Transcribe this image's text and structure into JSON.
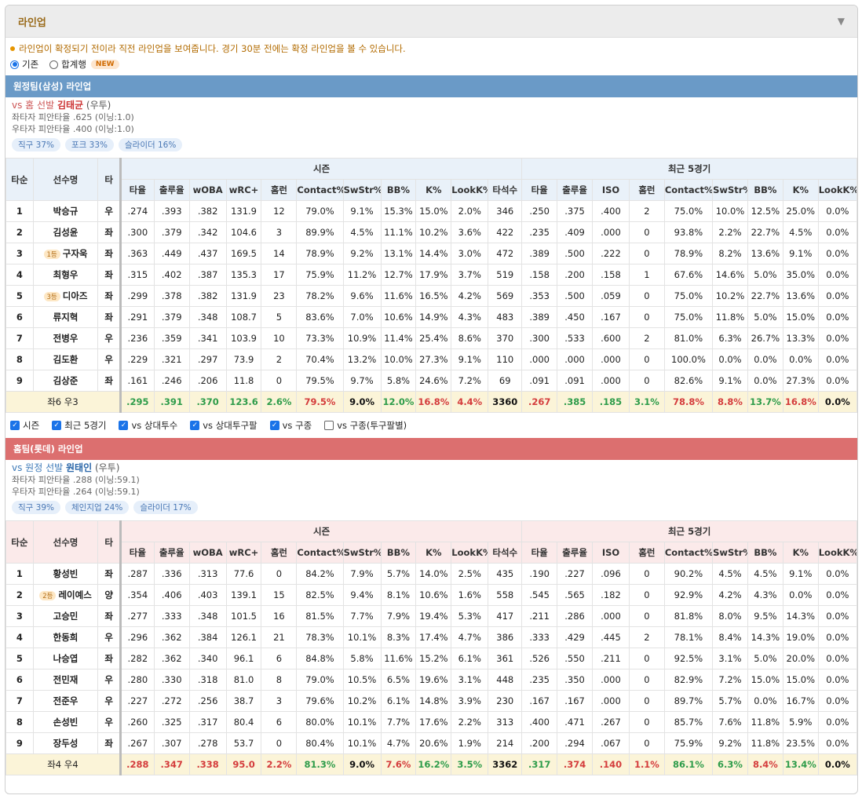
{
  "panel": {
    "title": "라인업"
  },
  "notice": "라인업이 확정되기 전이라 직전 라인업을 보여줍니다. 경기 30분 전에는 확정 라인업을 볼 수 있습니다.",
  "view_options": [
    {
      "label": "기존",
      "selected": true
    },
    {
      "label": "합계행",
      "selected": false,
      "badge": "NEW"
    }
  ],
  "headers": {
    "order": "타순",
    "name": "선수명",
    "hand": "타",
    "group_season": "시즌",
    "group_recent": "최근 5경기",
    "season_cols": [
      "타율",
      "출루율",
      "wOBA",
      "wRC+",
      "홈런",
      "Contact%",
      "SwStr%",
      "BB%",
      "K%",
      "LookK%",
      "타석수"
    ],
    "recent_cols": [
      "타율",
      "출루율",
      "ISO",
      "홈런",
      "Contact%",
      "SwStr%",
      "BB%",
      "K%",
      "LookK%"
    ]
  },
  "away": {
    "bar_title": "원정팀(삼성) 라인업",
    "vs_prefix": "vs 홈 선발",
    "pitcher_name": "김태균",
    "pitcher_hand": "(우투)",
    "split_l": "좌타자 피안타율 .625 (이닝:1.0)",
    "split_r": "우타자 피안타율 .400 (이닝:1.0)",
    "pitches": [
      "직구 37%",
      "포크 33%",
      "슬라이더 16%"
    ],
    "rows": [
      {
        "order": "1",
        "tag": "",
        "name": "박승규",
        "hand": "우",
        "season": [
          ".274",
          ".393",
          ".382",
          "131.9",
          "12",
          "79.0%",
          "9.1%",
          "15.3%",
          "15.0%",
          "2.0%",
          "346"
        ],
        "recent": [
          ".250",
          ".375",
          ".400",
          "2",
          "75.0%",
          "10.0%",
          "12.5%",
          "25.0%",
          "0.0%"
        ]
      },
      {
        "order": "2",
        "tag": "",
        "name": "김성윤",
        "hand": "좌",
        "season": [
          ".300",
          ".379",
          ".342",
          "104.6",
          "3",
          "89.9%",
          "4.5%",
          "11.1%",
          "10.2%",
          "3.6%",
          "422"
        ],
        "recent": [
          ".235",
          ".409",
          ".000",
          "0",
          "93.8%",
          "2.2%",
          "22.7%",
          "4.5%",
          "0.0%"
        ]
      },
      {
        "order": "3",
        "tag": "1등",
        "name": "구자욱",
        "hand": "좌",
        "season": [
          ".363",
          ".449",
          ".437",
          "169.5",
          "14",
          "78.9%",
          "9.2%",
          "13.1%",
          "14.4%",
          "3.0%",
          "472"
        ],
        "recent": [
          ".389",
          ".500",
          ".222",
          "0",
          "78.9%",
          "8.2%",
          "13.6%",
          "9.1%",
          "0.0%"
        ]
      },
      {
        "order": "4",
        "tag": "",
        "name": "최형우",
        "hand": "좌",
        "season": [
          ".315",
          ".402",
          ".387",
          "135.3",
          "17",
          "75.9%",
          "11.2%",
          "12.7%",
          "17.9%",
          "3.7%",
          "519"
        ],
        "recent": [
          ".158",
          ".200",
          ".158",
          "1",
          "67.6%",
          "14.6%",
          "5.0%",
          "35.0%",
          "0.0%"
        ]
      },
      {
        "order": "5",
        "tag": "3등",
        "name": "디아즈",
        "hand": "좌",
        "season": [
          ".299",
          ".378",
          ".382",
          "131.9",
          "23",
          "78.2%",
          "9.6%",
          "11.6%",
          "16.5%",
          "4.2%",
          "569"
        ],
        "recent": [
          ".353",
          ".500",
          ".059",
          "0",
          "75.0%",
          "10.2%",
          "22.7%",
          "13.6%",
          "0.0%"
        ]
      },
      {
        "order": "6",
        "tag": "",
        "name": "류지혁",
        "hand": "좌",
        "season": [
          ".291",
          ".379",
          ".348",
          "108.7",
          "5",
          "83.6%",
          "7.0%",
          "10.6%",
          "14.9%",
          "4.3%",
          "483"
        ],
        "recent": [
          ".389",
          ".450",
          ".167",
          "0",
          "75.0%",
          "11.8%",
          "5.0%",
          "15.0%",
          "0.0%"
        ]
      },
      {
        "order": "7",
        "tag": "",
        "name": "전병우",
        "hand": "우",
        "season": [
          ".236",
          ".359",
          ".341",
          "103.9",
          "10",
          "73.3%",
          "10.9%",
          "11.4%",
          "25.4%",
          "8.6%",
          "370"
        ],
        "recent": [
          ".300",
          ".533",
          ".600",
          "2",
          "81.0%",
          "6.3%",
          "26.7%",
          "13.3%",
          "0.0%"
        ]
      },
      {
        "order": "8",
        "tag": "",
        "name": "김도환",
        "hand": "우",
        "season": [
          ".229",
          ".321",
          ".297",
          "73.9",
          "2",
          "70.4%",
          "13.2%",
          "10.0%",
          "27.3%",
          "9.1%",
          "110"
        ],
        "recent": [
          ".000",
          ".000",
          ".000",
          "0",
          "100.0%",
          "0.0%",
          "0.0%",
          "0.0%",
          "0.0%"
        ]
      },
      {
        "order": "9",
        "tag": "",
        "name": "김상준",
        "hand": "좌",
        "season": [
          ".161",
          ".246",
          ".206",
          "11.8",
          "0",
          "79.5%",
          "9.7%",
          "5.8%",
          "24.6%",
          "7.2%",
          "69"
        ],
        "recent": [
          ".091",
          ".091",
          ".000",
          "0",
          "82.6%",
          "9.1%",
          "0.0%",
          "27.3%",
          "0.0%"
        ]
      }
    ],
    "summary_pre": "좌",
    "summary_l": "6",
    "summary_mid": " 우",
    "summary_r": "3",
    "summary_season": [
      ".295",
      ".391",
      ".370",
      "123.6",
      "2.6%",
      "79.5%",
      "9.0%",
      "12.0%",
      "16.8%",
      "4.4%",
      "3360"
    ],
    "summary_recent": [
      ".267",
      ".385",
      ".185",
      "3.1%",
      "78.8%",
      "8.8%",
      "13.7%",
      "16.8%",
      "0.0%"
    ],
    "summary_season_colors": [
      "g",
      "g",
      "g",
      "g",
      "g",
      "r",
      "k",
      "g",
      "r",
      "r",
      "k"
    ],
    "summary_recent_colors": [
      "r",
      "g",
      "g",
      "g",
      "r",
      "r",
      "g",
      "r",
      "k"
    ]
  },
  "filters": [
    {
      "label": "시즌",
      "checked": true
    },
    {
      "label": "최근 5경기",
      "checked": true
    },
    {
      "label": "vs 상대투수",
      "checked": true
    },
    {
      "label": "vs 상대투구팔",
      "checked": true
    },
    {
      "label": "vs 구종",
      "checked": true
    },
    {
      "label": "vs 구종(투구팔별)",
      "checked": false
    }
  ],
  "home": {
    "bar_title": "홈팀(롯데) 라인업",
    "vs_prefix": "vs 원정 선발",
    "pitcher_name": "원태인",
    "pitcher_hand": "(우투)",
    "split_l": "좌타자 피안타율 .288 (이닝:59.1)",
    "split_r": "우타자 피안타율 .264 (이닝:59.1)",
    "pitches": [
      "직구 39%",
      "체인지업 24%",
      "슬라이더 17%"
    ],
    "rows": [
      {
        "order": "1",
        "tag": "",
        "name": "황성빈",
        "hand": "좌",
        "season": [
          ".287",
          ".336",
          ".313",
          "77.6",
          "0",
          "84.2%",
          "7.9%",
          "5.7%",
          "14.0%",
          "2.5%",
          "435"
        ],
        "recent": [
          ".190",
          ".227",
          ".096",
          "0",
          "90.2%",
          "4.5%",
          "4.5%",
          "9.1%",
          "0.0%"
        ]
      },
      {
        "order": "2",
        "tag": "2등",
        "name": "레이예스",
        "hand": "양",
        "season": [
          ".354",
          ".406",
          ".403",
          "139.1",
          "15",
          "82.5%",
          "9.4%",
          "8.1%",
          "10.6%",
          "1.6%",
          "558"
        ],
        "recent": [
          ".545",
          ".565",
          ".182",
          "0",
          "92.9%",
          "4.2%",
          "4.3%",
          "0.0%",
          "0.0%"
        ]
      },
      {
        "order": "3",
        "tag": "",
        "name": "고승민",
        "hand": "좌",
        "season": [
          ".277",
          ".333",
          ".348",
          "101.5",
          "16",
          "81.5%",
          "7.7%",
          "7.9%",
          "19.4%",
          "5.3%",
          "417"
        ],
        "recent": [
          ".211",
          ".286",
          ".000",
          "0",
          "81.8%",
          "8.0%",
          "9.5%",
          "14.3%",
          "0.0%"
        ]
      },
      {
        "order": "4",
        "tag": "",
        "name": "한동희",
        "hand": "우",
        "season": [
          ".296",
          ".362",
          ".384",
          "126.1",
          "21",
          "78.3%",
          "10.1%",
          "8.3%",
          "17.4%",
          "4.7%",
          "386"
        ],
        "recent": [
          ".333",
          ".429",
          ".445",
          "2",
          "78.1%",
          "8.4%",
          "14.3%",
          "19.0%",
          "0.0%"
        ]
      },
      {
        "order": "5",
        "tag": "",
        "name": "나승엽",
        "hand": "좌",
        "season": [
          ".282",
          ".362",
          ".340",
          "96.1",
          "6",
          "84.8%",
          "5.8%",
          "11.6%",
          "15.2%",
          "6.1%",
          "361"
        ],
        "recent": [
          ".526",
          ".550",
          ".211",
          "0",
          "92.5%",
          "3.1%",
          "5.0%",
          "20.0%",
          "0.0%"
        ]
      },
      {
        "order": "6",
        "tag": "",
        "name": "전민재",
        "hand": "우",
        "season": [
          ".280",
          ".330",
          ".318",
          "81.0",
          "8",
          "79.0%",
          "10.5%",
          "6.5%",
          "19.6%",
          "3.1%",
          "448"
        ],
        "recent": [
          ".235",
          ".350",
          ".000",
          "0",
          "82.9%",
          "7.2%",
          "15.0%",
          "15.0%",
          "0.0%"
        ]
      },
      {
        "order": "7",
        "tag": "",
        "name": "전준우",
        "hand": "우",
        "season": [
          ".227",
          ".272",
          ".256",
          "38.7",
          "3",
          "79.6%",
          "10.2%",
          "6.1%",
          "14.8%",
          "3.9%",
          "230"
        ],
        "recent": [
          ".167",
          ".167",
          ".000",
          "0",
          "89.7%",
          "5.7%",
          "0.0%",
          "16.7%",
          "0.0%"
        ]
      },
      {
        "order": "8",
        "tag": "",
        "name": "손성빈",
        "hand": "우",
        "season": [
          ".260",
          ".325",
          ".317",
          "80.4",
          "6",
          "80.0%",
          "10.1%",
          "7.7%",
          "17.6%",
          "2.2%",
          "313"
        ],
        "recent": [
          ".400",
          ".471",
          ".267",
          "0",
          "85.7%",
          "7.6%",
          "11.8%",
          "5.9%",
          "0.0%"
        ]
      },
      {
        "order": "9",
        "tag": "",
        "name": "장두성",
        "hand": "좌",
        "season": [
          ".267",
          ".307",
          ".278",
          "53.7",
          "0",
          "80.4%",
          "10.1%",
          "4.7%",
          "20.6%",
          "1.9%",
          "214"
        ],
        "recent": [
          ".200",
          ".294",
          ".067",
          "0",
          "75.9%",
          "9.2%",
          "11.8%",
          "23.5%",
          "0.0%"
        ]
      }
    ],
    "summary_pre": "좌",
    "summary_l": "4",
    "summary_mid": " 우",
    "summary_r": "4",
    "summary_season": [
      ".288",
      ".347",
      ".338",
      "95.0",
      "2.2%",
      "81.3%",
      "9.0%",
      "7.6%",
      "16.2%",
      "3.5%",
      "3362"
    ],
    "summary_recent": [
      ".317",
      ".374",
      ".140",
      "1.1%",
      "86.1%",
      "6.3%",
      "8.4%",
      "13.4%",
      "0.0%"
    ],
    "summary_season_colors": [
      "r",
      "r",
      "r",
      "r",
      "r",
      "g",
      "k",
      "r",
      "g",
      "g",
      "k"
    ],
    "summary_recent_colors": [
      "g",
      "r",
      "r",
      "r",
      "g",
      "g",
      "r",
      "g",
      "k"
    ]
  }
}
